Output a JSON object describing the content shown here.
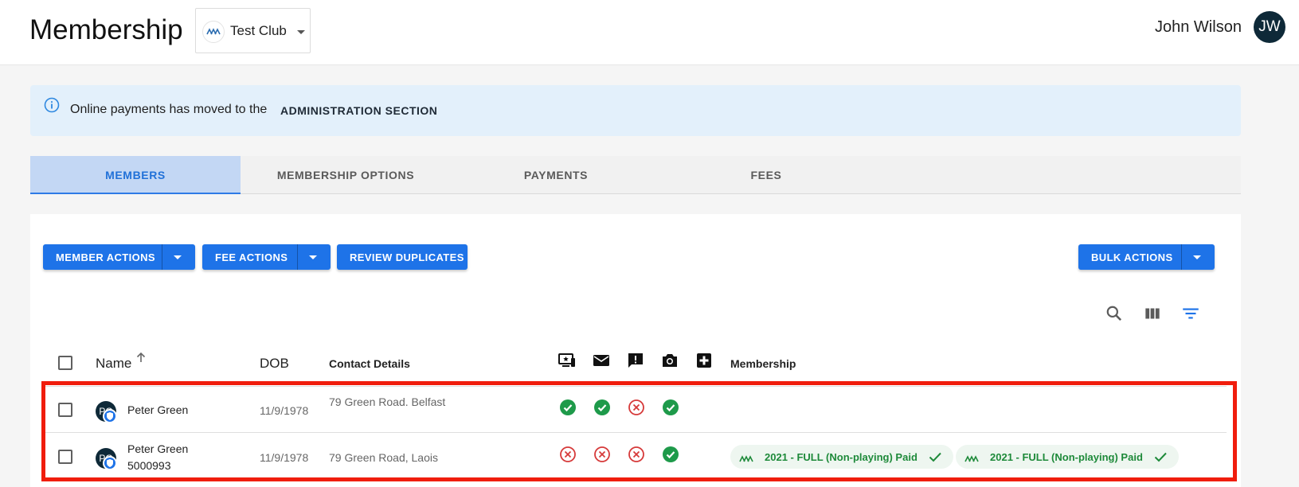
{
  "header": {
    "title": "Membership",
    "club_name": "Test Club",
    "user_name": "John Wilson",
    "user_initials": "JW"
  },
  "banner": {
    "text": "Online payments has moved to the",
    "link": "ADMINISTRATION SECTION"
  },
  "tabs": [
    {
      "label": "MEMBERS",
      "active": true
    },
    {
      "label": "MEMBERSHIP OPTIONS",
      "active": false
    },
    {
      "label": "PAYMENTS",
      "active": false
    },
    {
      "label": "FEES",
      "active": false
    }
  ],
  "toolbar": {
    "member_actions": "MEMBER ACTIONS",
    "fee_actions": "FEE ACTIONS",
    "review_duplicates": "REVIEW DUPLICATES",
    "bulk_actions": "BULK ACTIONS"
  },
  "table_tools": [
    "search-icon",
    "columns-icon",
    "filter-icon"
  ],
  "table": {
    "columns": {
      "name": "Name",
      "dob": "DOB",
      "contact": "Contact Details",
      "membership": "Membership"
    },
    "status_columns": [
      "online-portal-icon",
      "email-icon",
      "feedback-icon",
      "photo-icon",
      "medical-icon"
    ],
    "rows": [
      {
        "initials": "PG",
        "name": "Peter Green",
        "member_id": "",
        "dob": "11/9/1978",
        "contact": "79 Green Road. Belfast",
        "status": [
          "ok",
          "ok",
          "error",
          "ok"
        ],
        "memberships": []
      },
      {
        "initials": "PG",
        "name": "Peter Green",
        "member_id": "5000993",
        "dob": "11/9/1978",
        "contact": "79 Green Road, Laois",
        "status": [
          "error",
          "error",
          "error",
          "ok"
        ],
        "memberships": [
          "2021 - FULL (Non-playing) Paid",
          "2021 - FULL (Non-playing) Paid"
        ]
      }
    ]
  },
  "colors": {
    "primary": "#1e73e8",
    "active_tab_bg": "#c3d7f4",
    "banner_bg": "#e3f0fb",
    "ok": "#1e9a4a",
    "error": "#d63a3a",
    "highlight": "#f01d0d"
  }
}
